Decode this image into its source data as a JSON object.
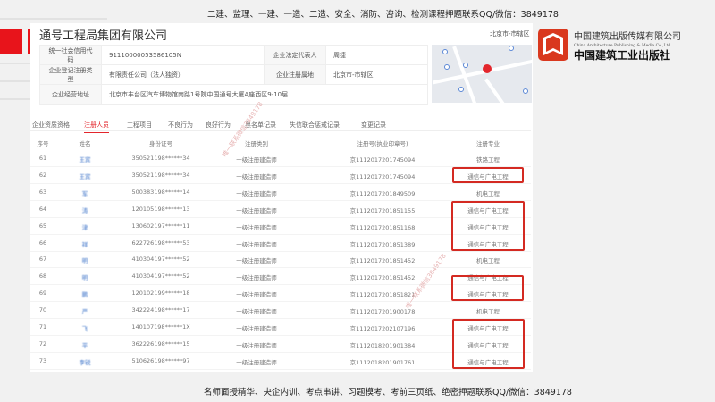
{
  "banner_top": "二建、监理、一建、一造、二造、安全、消防、咨询、检测课程押题联系QQ/微信：3849178",
  "banner_bottom": "名师面授精华、央企内训、考点串讲、习题模考、考前三页纸、绝密押题联系QQ/微信：3849178",
  "company": {
    "name": "通号工程局集团有限公司",
    "region": "北京市-市辖区",
    "fields": {
      "credit_code_label": "统一社会信用代码",
      "credit_code": "91110000053586105N",
      "legal_rep_label": "企业法定代表人",
      "legal_rep": "周捷",
      "reg_type_label": "企业登记注册类型",
      "reg_type": "有限责任公司（法人独资）",
      "reg_place_label": "企业注册属地",
      "reg_place": "北京市-市辖区",
      "address_label": "企业经营地址",
      "address": "北京市丰台区汽车博物馆南路1号院中国通号大厦A座西区9-10层"
    }
  },
  "logo": {
    "cn": "中国建筑出版传媒有限公司",
    "en": "China Architecture Publishing & Media Co.,Ltd",
    "sub": "中国建筑工业出版社",
    "color": "#d9381e"
  },
  "tabs": [
    "企业资质资格",
    "注册人员",
    "工程项目",
    "不良行为",
    "良好行为",
    "黑名单记录",
    "失信联合惩戒记录",
    "变更记录"
  ],
  "active_tab": 1,
  "table": {
    "headers": [
      "序号",
      "姓名",
      "身份证号",
      "注册类别",
      "注册号(执业印章号)",
      "注册专业"
    ],
    "rows": [
      [
        "61",
        "王宾",
        "350521198******34",
        "一级注册建造师",
        "京1112017201745094",
        "铁路工程"
      ],
      [
        "62",
        "王宾",
        "350521198******34",
        "一级注册建造师",
        "京1112017201745094",
        "通信与广电工程"
      ],
      [
        "63",
        "军",
        "500383198******14",
        "一级注册建造师",
        "京1112017201849509",
        "机电工程"
      ],
      [
        "64",
        "涛",
        "120105198******13",
        "一级注册建造师",
        "京1112017201851155",
        "通信与广电工程"
      ],
      [
        "65",
        "津",
        "130602197******11",
        "一级注册建造师",
        "京1112017201851168",
        "通信与广电工程"
      ],
      [
        "66",
        "祥",
        "622726198******53",
        "一级注册建造师",
        "京1112017201851389",
        "通信与广电工程"
      ],
      [
        "67",
        "明",
        "410304197******52",
        "一级注册建造师",
        "京1112017201851452",
        "机电工程"
      ],
      [
        "68",
        "明",
        "410304197******52",
        "一级注册建造师",
        "京1112017201851452",
        "通信与广电工程"
      ],
      [
        "69",
        "鹏",
        "120102199******18",
        "一级注册建造师",
        "京1112017201851821",
        "通信与广电工程"
      ],
      [
        "70",
        "严",
        "342224198******17",
        "一级注册建造师",
        "京1112017201900178",
        "机电工程"
      ],
      [
        "71",
        "飞",
        "140107198******1X",
        "一级注册建造师",
        "京1112017202107196",
        "通信与广电工程"
      ],
      [
        "72",
        "平",
        "362226198******15",
        "一级注册建造师",
        "京1112018201901384",
        "通信与广电工程"
      ],
      [
        "73",
        "李锐",
        "510626198******97",
        "一级注册建造师",
        "京1112018201901761",
        "通信与广电工程"
      ]
    ]
  },
  "highlight_color": "#d42a22"
}
